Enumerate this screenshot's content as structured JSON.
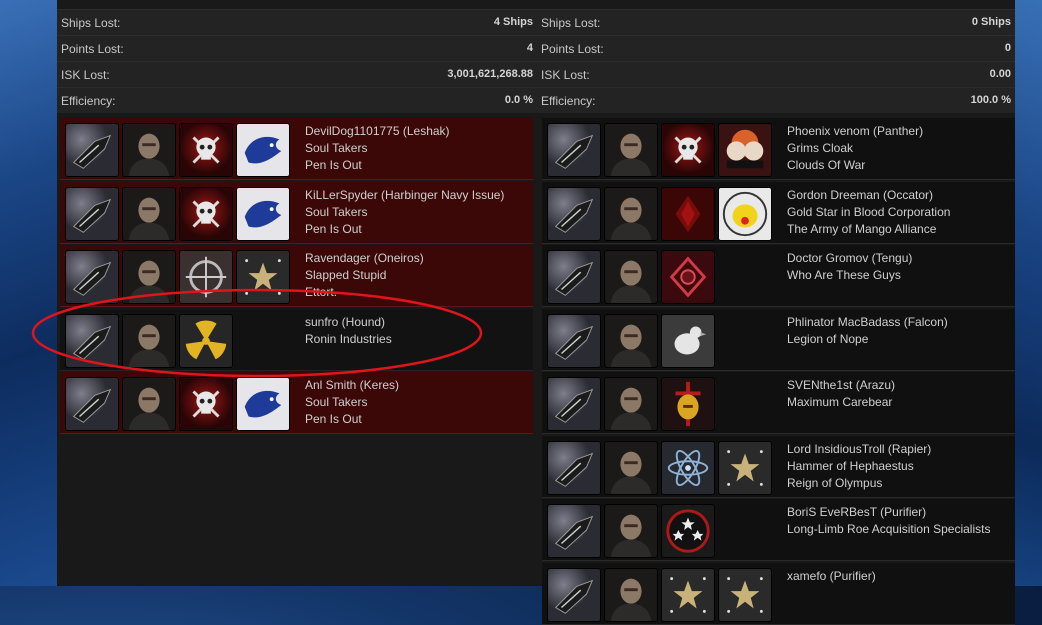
{
  "stats": {
    "left": [
      {
        "label": "Ships Lost:",
        "value": "4 Ships"
      },
      {
        "label": "Points Lost:",
        "value": "4"
      },
      {
        "label": "ISK Lost:",
        "value": "3,001,621,268.88"
      },
      {
        "label": "Efficiency:",
        "value": "0.0 %"
      }
    ],
    "right": [
      {
        "label": "Ships Lost:",
        "value": "0 Ships"
      },
      {
        "label": "Points Lost:",
        "value": "0"
      },
      {
        "label": "ISK Lost:",
        "value": "0.00"
      },
      {
        "label": "Efficiency:",
        "value": "100.0 %"
      }
    ]
  },
  "colors": {
    "loss_row": "#3b0707",
    "annotation": "#e0141b",
    "panel": "#191919"
  },
  "left_pilots": [
    {
      "line1": "DevilDog1101775 (Leshak)",
      "line2": "Soul Takers",
      "line3": "Pen Is Out",
      "tiles": [
        "ship-icon",
        "portrait-icon",
        "skull-icon",
        "lion-logo-icon"
      ],
      "lost": true
    },
    {
      "line1": "KiLLerSpyder (Harbinger Navy Issue)",
      "line2": "Soul Takers",
      "line3": "Pen Is Out",
      "tiles": [
        "ship-icon",
        "portrait-icon",
        "skull-icon",
        "lion-logo-icon"
      ],
      "lost": true
    },
    {
      "line1": "Ravendager (Oneiros)",
      "line2": "Slapped Stupid",
      "line3": "Ettort.",
      "tiles": [
        "ship-icon",
        "portrait-icon",
        "crosshair-icon",
        "star-icon"
      ],
      "lost": true
    },
    {
      "line1": "sunfro (Hound)",
      "line2": "Ronin Industries",
      "line3": "",
      "tiles": [
        "ship-icon",
        "portrait-icon",
        "radiation-icon"
      ],
      "lost": false
    },
    {
      "line1": "Anl Smith (Keres)",
      "line2": "Soul Takers",
      "line3": "Pen Is Out",
      "tiles": [
        "ship-icon",
        "portrait-icon",
        "skull-icon",
        "lion-logo-icon"
      ],
      "lost": true
    }
  ],
  "right_pilots": [
    {
      "line1": "Phoenix venom (Panther)",
      "line2": "Grims Cloak",
      "line3": "Clouds Of War",
      "tiles": [
        "ship-icon",
        "portrait-icon",
        "skull-icon",
        "clouds-logo-icon"
      ]
    },
    {
      "line1": "Gordon Dreeman (Occator)",
      "line2": "Gold Star in Blood Corporation",
      "line3": "The Army of Mango Alliance",
      "tiles": [
        "ship-icon",
        "portrait-icon",
        "red-logo-icon",
        "mango-logo-icon"
      ]
    },
    {
      "line1": "Doctor Gromov (Tengu)",
      "line2": "Who Are These Guys",
      "line3": "",
      "tiles": [
        "ship-icon",
        "portrait-icon",
        "diamond-logo-icon"
      ]
    },
    {
      "line1": "Phlinator MacBadass (Falcon)",
      "line2": "Legion of Nope",
      "line3": "",
      "tiles": [
        "ship-icon",
        "portrait-icon",
        "chicken-logo-icon"
      ]
    },
    {
      "line1": "SVENthe1st (Arazu)",
      "line2": "Maximum Carebear",
      "line3": "",
      "tiles": [
        "ship-icon",
        "portrait-icon",
        "helmet-logo-icon"
      ]
    },
    {
      "line1": "Lord InsidiousTroll (Rapier)",
      "line2": "Hammer of Hephaestus",
      "line3": "Reign of Olympus",
      "tiles": [
        "ship-icon",
        "portrait-icon",
        "atom-icon",
        "star-icon"
      ]
    },
    {
      "line1": "BoriS EveRBesT (Purifier)",
      "line2": "Long-Limb Roe Acquisition Specialists",
      "line3": "",
      "tiles": [
        "ship-icon",
        "portrait-icon",
        "stars-circle-icon"
      ]
    },
    {
      "line1": "xamefo (Purifier)",
      "line2": "",
      "line3": "",
      "tiles": [
        "ship-icon",
        "portrait-icon",
        "star-icon",
        "star-icon"
      ]
    }
  ]
}
